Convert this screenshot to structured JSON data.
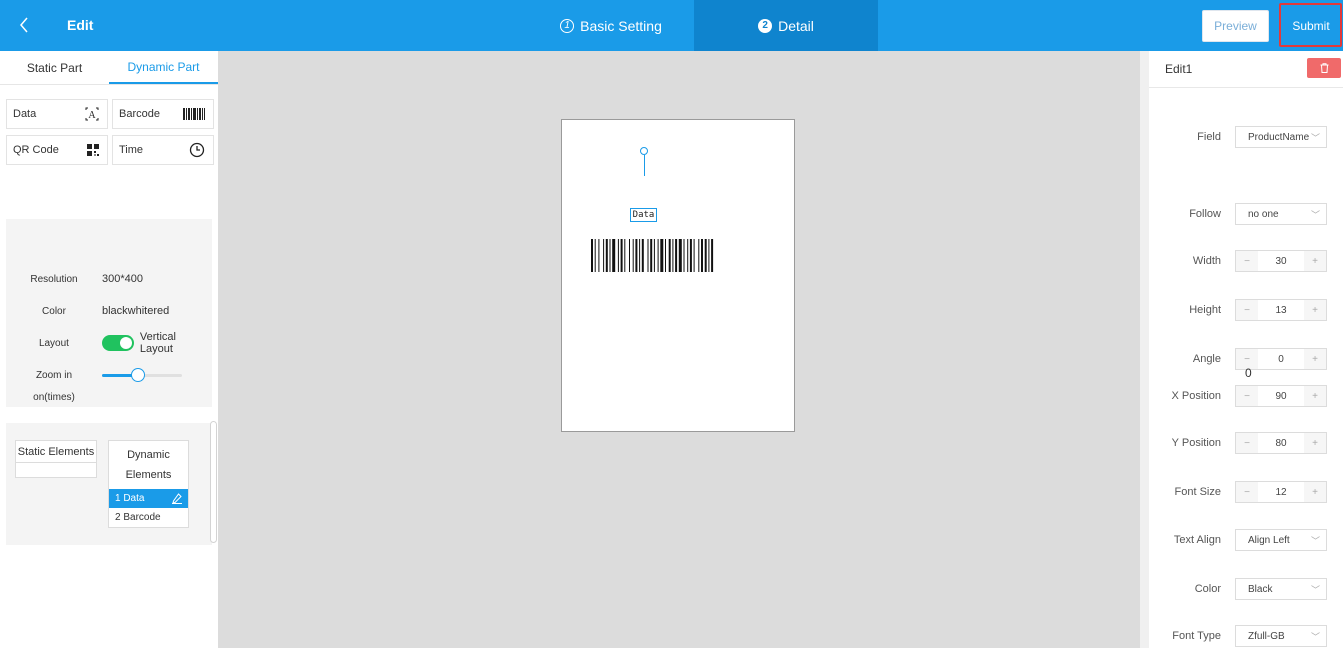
{
  "header": {
    "title": "Edit",
    "steps": [
      {
        "num": "1",
        "label": "Basic Setting"
      },
      {
        "num": "2",
        "label": "Detail"
      }
    ],
    "preview_label": "Preview",
    "submit_label": "Submit",
    "colors": {
      "bar": "#1a9be8",
      "active_step": "#0f84ce",
      "highlight": "#e23a3a"
    }
  },
  "left": {
    "tabs": [
      "Static Part",
      "Dynamic Part"
    ],
    "active_tab": "Dynamic Part",
    "tools": [
      {
        "label": "Data",
        "icon": "text-box-icon"
      },
      {
        "label": "Barcode",
        "icon": "barcode-icon"
      },
      {
        "label": "QR Code",
        "icon": "qrcode-icon"
      },
      {
        "label": "Time",
        "icon": "clock-icon"
      }
    ],
    "props": {
      "resolution_label": "Resolution",
      "resolution_value": "300*400",
      "color_label": "Color",
      "color_value": "blackwhitered",
      "layout_label": "Layout",
      "layout_value": "Vertical Layout",
      "layout_on": true,
      "zoom_label": "Zoom in",
      "zoom_label2": "on(times)",
      "zoom_level": 0.45
    },
    "elements": {
      "static_header": "Static Elements",
      "dynamic_header": "Dynamic Elements",
      "dynamic_items": [
        "1 Data",
        "2 Barcode"
      ],
      "selected_index": 0
    }
  },
  "canvas": {
    "data_text": "Data",
    "background": "#dcdcdc"
  },
  "right": {
    "title": "Edit1",
    "fields": {
      "field_label": "Field",
      "field_value": "ProductName",
      "follow_label": "Follow",
      "follow_value": "no one",
      "width_label": "Width",
      "width_value": "30",
      "height_label": "Height",
      "height_value": "13",
      "angle_label": "Angle",
      "angle_value": "0",
      "zero_text": "0",
      "xpos_label": "X Position",
      "xpos_value": "90",
      "ypos_label": "Y Position",
      "ypos_value": "80",
      "fontsize_label": "Font Size",
      "fontsize_value": "12",
      "textalign_label": "Text Align",
      "textalign_value": "Align Left",
      "color_label": "Color",
      "color_value": "Black",
      "fonttype_label": "Font Type",
      "fonttype_value": "Zfull-GB"
    },
    "delete_color": "#f06a6a"
  }
}
